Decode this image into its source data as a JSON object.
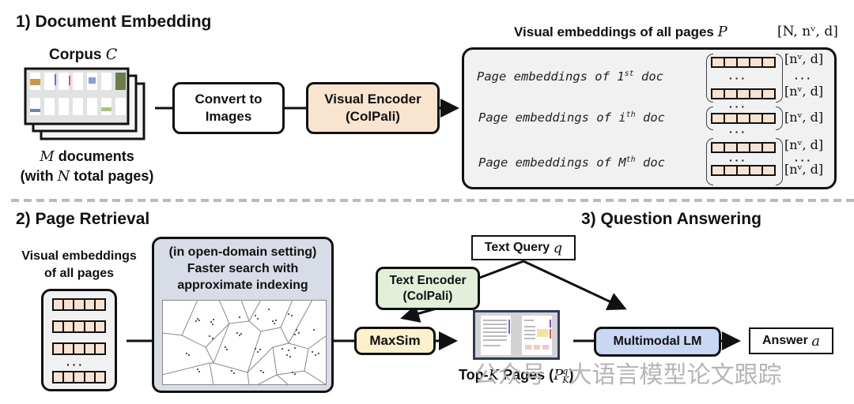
{
  "section1": {
    "title": "1) Document Embedding",
    "corpus_label": "Corpus",
    "corpus_symbol": "C",
    "docs_caption_line1_symbol": "M",
    "docs_caption_line1_text": " documents",
    "docs_caption_line2_prefix": "(with ",
    "docs_caption_line2_symbol": "N",
    "docs_caption_line2_suffix": " total pages)",
    "convert_box": {
      "line1": "Convert to",
      "line2": "Images"
    },
    "visual_encoder_box": {
      "line1": "Visual Encoder",
      "line2": "(ColPali)"
    },
    "embeddings_title": "Visual embeddings of all pages",
    "embeddings_symbol": "P",
    "embeddings_shape": "[N, nᵛ, d]",
    "rows": [
      {
        "label_prefix": "Page embeddings of 1",
        "label_sup": "st",
        "label_suffix": " doc"
      },
      {
        "label_prefix": "Page embeddings of i",
        "label_sup": "th",
        "label_suffix": " doc"
      },
      {
        "label_prefix": "Page embeddings of M",
        "label_sup": "th",
        "label_suffix": " doc"
      }
    ],
    "row_shape": "[nᵛ, d]",
    "ellipsis": "···"
  },
  "section2": {
    "title": "2) Page Retrieval",
    "embeddings_label_line1": "Visual embeddings",
    "embeddings_label_line2": "of all pages",
    "index_box": {
      "line1": "(in open-domain setting)",
      "line2": "Faster search with",
      "line3": "approximate indexing"
    },
    "text_query": {
      "label": "Text Query ",
      "symbol": "q"
    },
    "text_encoder_box": {
      "line1": "Text Encoder",
      "line2": "(ColPali)"
    },
    "maxsim_label": "MaxSim",
    "topk_caption": {
      "prefix": "Top-",
      "k_symbol": "K",
      "middle": " Pages (",
      "p_symbol": "P",
      "sup": "q",
      "sub": "K",
      "suffix": ")"
    }
  },
  "section3": {
    "title": "3) Question Answering",
    "mlm_label": "Multimodal LM",
    "answer": {
      "label": "Answer ",
      "symbol": "a"
    }
  },
  "watermark": "公众号 · 大语言模型论文跟踪",
  "colors": {
    "visual_encoder_fill": "#f8e4cf",
    "text_encoder_fill": "#e3efd9",
    "maxsim_fill": "#fdf0cc",
    "mlm_fill": "#c9d7f5",
    "index_box_fill": "#d7dce6",
    "embeddings_panel_fill": "#f1f1f1",
    "embedding_cell": "#f8e2d2",
    "divider": "#bbbbbb"
  }
}
